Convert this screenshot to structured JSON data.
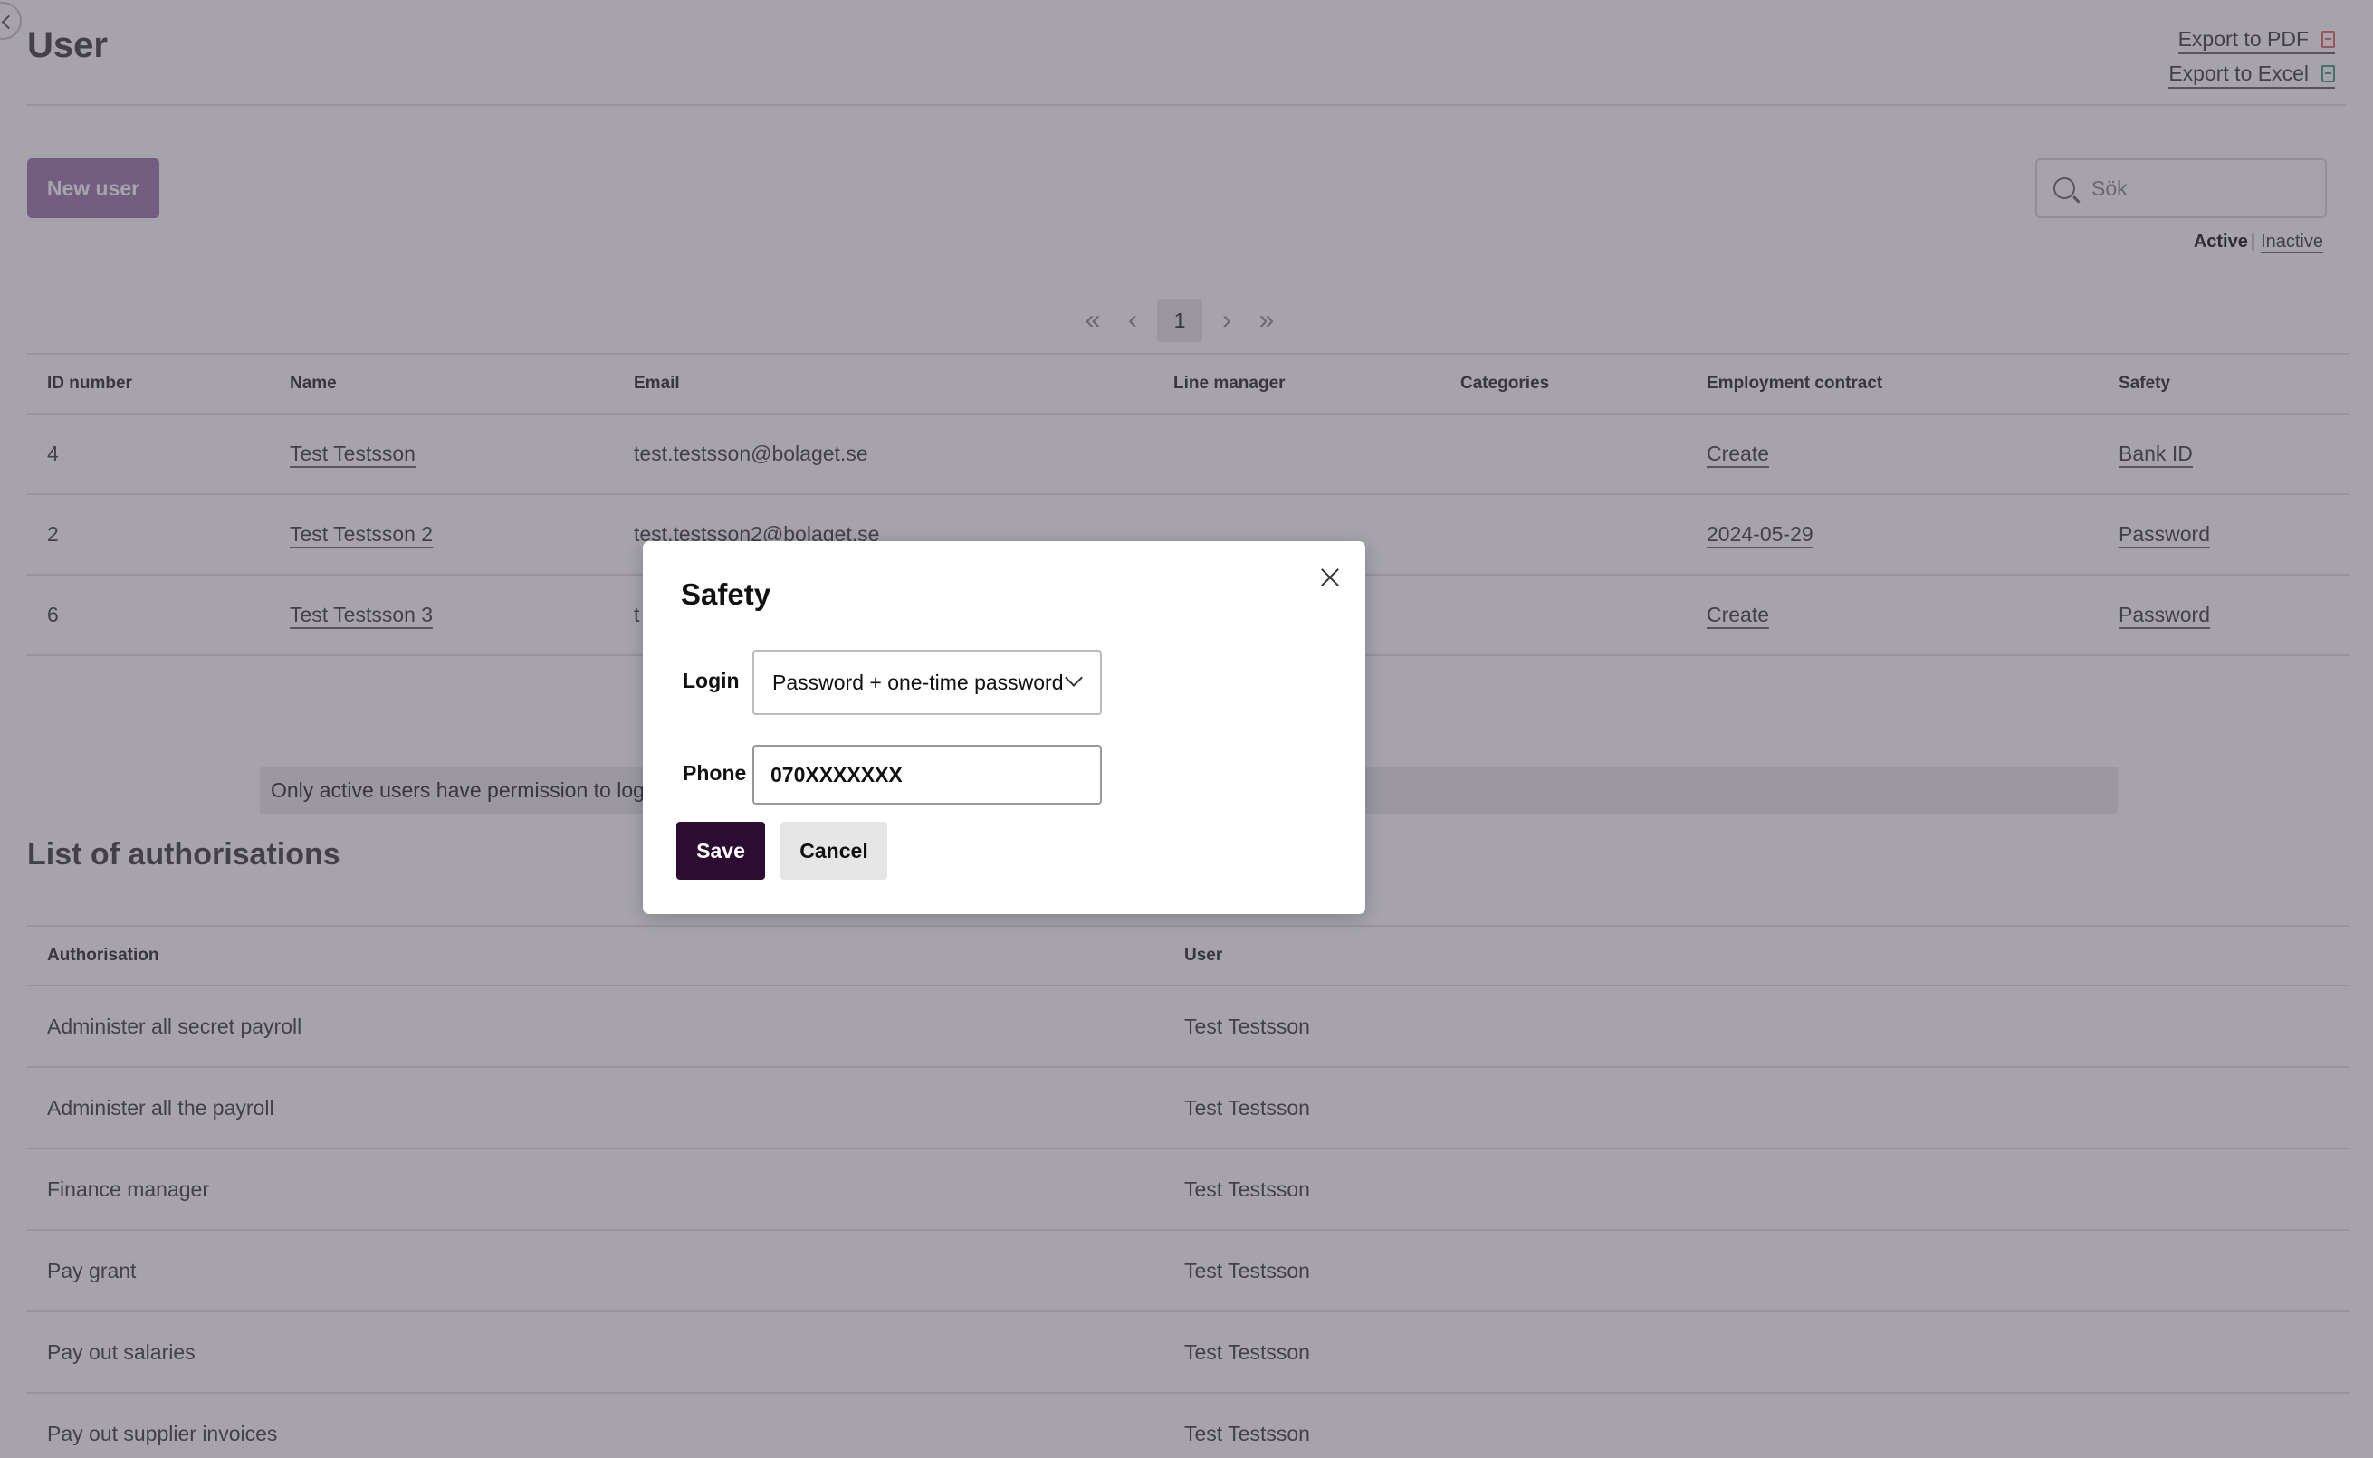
{
  "page": {
    "title": "User",
    "export_pdf": "Export to PDF",
    "export_excel": "Export to Excel",
    "new_user_label": "New user",
    "search_placeholder": "Sök",
    "filter": {
      "active": "Active",
      "separator": "|",
      "inactive": "Inactive"
    },
    "pagination": {
      "first": "«",
      "prev": "‹",
      "current": "1",
      "next": "›",
      "last": "»"
    }
  },
  "users_table": {
    "headers": [
      "ID number",
      "Name",
      "Email",
      "Line manager",
      "Categories",
      "Employment contract",
      "Safety"
    ],
    "rows": [
      {
        "id": "4",
        "name": "Test Testsson",
        "email": "test.testsson@bolaget.se",
        "line_manager": "",
        "categories": "",
        "contract": "Create",
        "safety": "Bank ID"
      },
      {
        "id": "2",
        "name": "Test Testsson 2",
        "email": "test.testsson2@bolaget.se",
        "line_manager": "",
        "categories": "",
        "contract": "2024-05-29",
        "safety": "Password"
      },
      {
        "id": "6",
        "name": "Test Testsson 3",
        "email": "t",
        "line_manager": "",
        "categories": "",
        "contract": "Create",
        "safety": "Password"
      }
    ]
  },
  "info_banner": "Only active users have permission to log in",
  "authorisations": {
    "title": "List of authorisations",
    "headers": [
      "Authorisation",
      "User"
    ],
    "rows": [
      {
        "authorisation": "Administer all secret payroll",
        "user": "Test Testsson"
      },
      {
        "authorisation": "Administer all the payroll",
        "user": "Test Testsson"
      },
      {
        "authorisation": "Finance manager",
        "user": "Test Testsson"
      },
      {
        "authorisation": "Pay grant",
        "user": "Test Testsson"
      },
      {
        "authorisation": "Pay out salaries",
        "user": "Test Testsson"
      },
      {
        "authorisation": "Pay out supplier invoices",
        "user": "Test Testsson"
      }
    ]
  },
  "modal": {
    "title": "Safety",
    "login_label": "Login",
    "login_value": "Password + one-time password",
    "phone_label": "Phone",
    "phone_value": "070XXXXXXX",
    "save_label": "Save",
    "cancel_label": "Cancel"
  },
  "colors": {
    "primary_button": "#a888b8",
    "save_button": "#2c0c33",
    "overlay": "#2a2436"
  }
}
